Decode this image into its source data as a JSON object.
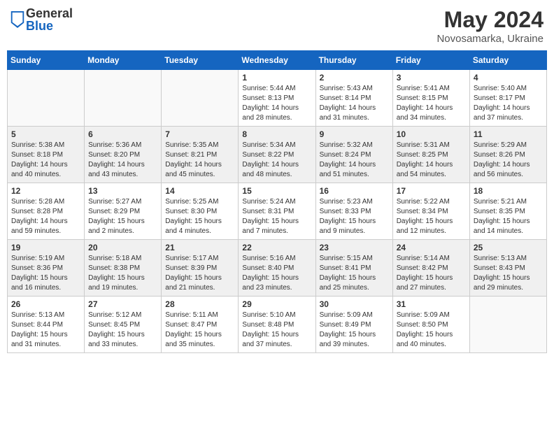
{
  "header": {
    "logo_general": "General",
    "logo_blue": "Blue",
    "month_year": "May 2024",
    "location": "Novosamarka, Ukraine"
  },
  "days_of_week": [
    "Sunday",
    "Monday",
    "Tuesday",
    "Wednesday",
    "Thursday",
    "Friday",
    "Saturday"
  ],
  "weeks": [
    {
      "shaded": false,
      "days": [
        {
          "number": "",
          "sunrise": "",
          "sunset": "",
          "daylight": "",
          "empty": true
        },
        {
          "number": "",
          "sunrise": "",
          "sunset": "",
          "daylight": "",
          "empty": true
        },
        {
          "number": "",
          "sunrise": "",
          "sunset": "",
          "daylight": "",
          "empty": true
        },
        {
          "number": "1",
          "sunrise": "Sunrise: 5:44 AM",
          "sunset": "Sunset: 8:13 PM",
          "daylight": "Daylight: 14 hours and 28 minutes.",
          "empty": false
        },
        {
          "number": "2",
          "sunrise": "Sunrise: 5:43 AM",
          "sunset": "Sunset: 8:14 PM",
          "daylight": "Daylight: 14 hours and 31 minutes.",
          "empty": false
        },
        {
          "number": "3",
          "sunrise": "Sunrise: 5:41 AM",
          "sunset": "Sunset: 8:15 PM",
          "daylight": "Daylight: 14 hours and 34 minutes.",
          "empty": false
        },
        {
          "number": "4",
          "sunrise": "Sunrise: 5:40 AM",
          "sunset": "Sunset: 8:17 PM",
          "daylight": "Daylight: 14 hours and 37 minutes.",
          "empty": false
        }
      ]
    },
    {
      "shaded": true,
      "days": [
        {
          "number": "5",
          "sunrise": "Sunrise: 5:38 AM",
          "sunset": "Sunset: 8:18 PM",
          "daylight": "Daylight: 14 hours and 40 minutes.",
          "empty": false
        },
        {
          "number": "6",
          "sunrise": "Sunrise: 5:36 AM",
          "sunset": "Sunset: 8:20 PM",
          "daylight": "Daylight: 14 hours and 43 minutes.",
          "empty": false
        },
        {
          "number": "7",
          "sunrise": "Sunrise: 5:35 AM",
          "sunset": "Sunset: 8:21 PM",
          "daylight": "Daylight: 14 hours and 45 minutes.",
          "empty": false
        },
        {
          "number": "8",
          "sunrise": "Sunrise: 5:34 AM",
          "sunset": "Sunset: 8:22 PM",
          "daylight": "Daylight: 14 hours and 48 minutes.",
          "empty": false
        },
        {
          "number": "9",
          "sunrise": "Sunrise: 5:32 AM",
          "sunset": "Sunset: 8:24 PM",
          "daylight": "Daylight: 14 hours and 51 minutes.",
          "empty": false
        },
        {
          "number": "10",
          "sunrise": "Sunrise: 5:31 AM",
          "sunset": "Sunset: 8:25 PM",
          "daylight": "Daylight: 14 hours and 54 minutes.",
          "empty": false
        },
        {
          "number": "11",
          "sunrise": "Sunrise: 5:29 AM",
          "sunset": "Sunset: 8:26 PM",
          "daylight": "Daylight: 14 hours and 56 minutes.",
          "empty": false
        }
      ]
    },
    {
      "shaded": false,
      "days": [
        {
          "number": "12",
          "sunrise": "Sunrise: 5:28 AM",
          "sunset": "Sunset: 8:28 PM",
          "daylight": "Daylight: 14 hours and 59 minutes.",
          "empty": false
        },
        {
          "number": "13",
          "sunrise": "Sunrise: 5:27 AM",
          "sunset": "Sunset: 8:29 PM",
          "daylight": "Daylight: 15 hours and 2 minutes.",
          "empty": false
        },
        {
          "number": "14",
          "sunrise": "Sunrise: 5:25 AM",
          "sunset": "Sunset: 8:30 PM",
          "daylight": "Daylight: 15 hours and 4 minutes.",
          "empty": false
        },
        {
          "number": "15",
          "sunrise": "Sunrise: 5:24 AM",
          "sunset": "Sunset: 8:31 PM",
          "daylight": "Daylight: 15 hours and 7 minutes.",
          "empty": false
        },
        {
          "number": "16",
          "sunrise": "Sunrise: 5:23 AM",
          "sunset": "Sunset: 8:33 PM",
          "daylight": "Daylight: 15 hours and 9 minutes.",
          "empty": false
        },
        {
          "number": "17",
          "sunrise": "Sunrise: 5:22 AM",
          "sunset": "Sunset: 8:34 PM",
          "daylight": "Daylight: 15 hours and 12 minutes.",
          "empty": false
        },
        {
          "number": "18",
          "sunrise": "Sunrise: 5:21 AM",
          "sunset": "Sunset: 8:35 PM",
          "daylight": "Daylight: 15 hours and 14 minutes.",
          "empty": false
        }
      ]
    },
    {
      "shaded": true,
      "days": [
        {
          "number": "19",
          "sunrise": "Sunrise: 5:19 AM",
          "sunset": "Sunset: 8:36 PM",
          "daylight": "Daylight: 15 hours and 16 minutes.",
          "empty": false
        },
        {
          "number": "20",
          "sunrise": "Sunrise: 5:18 AM",
          "sunset": "Sunset: 8:38 PM",
          "daylight": "Daylight: 15 hours and 19 minutes.",
          "empty": false
        },
        {
          "number": "21",
          "sunrise": "Sunrise: 5:17 AM",
          "sunset": "Sunset: 8:39 PM",
          "daylight": "Daylight: 15 hours and 21 minutes.",
          "empty": false
        },
        {
          "number": "22",
          "sunrise": "Sunrise: 5:16 AM",
          "sunset": "Sunset: 8:40 PM",
          "daylight": "Daylight: 15 hours and 23 minutes.",
          "empty": false
        },
        {
          "number": "23",
          "sunrise": "Sunrise: 5:15 AM",
          "sunset": "Sunset: 8:41 PM",
          "daylight": "Daylight: 15 hours and 25 minutes.",
          "empty": false
        },
        {
          "number": "24",
          "sunrise": "Sunrise: 5:14 AM",
          "sunset": "Sunset: 8:42 PM",
          "daylight": "Daylight: 15 hours and 27 minutes.",
          "empty": false
        },
        {
          "number": "25",
          "sunrise": "Sunrise: 5:13 AM",
          "sunset": "Sunset: 8:43 PM",
          "daylight": "Daylight: 15 hours and 29 minutes.",
          "empty": false
        }
      ]
    },
    {
      "shaded": false,
      "days": [
        {
          "number": "26",
          "sunrise": "Sunrise: 5:13 AM",
          "sunset": "Sunset: 8:44 PM",
          "daylight": "Daylight: 15 hours and 31 minutes.",
          "empty": false
        },
        {
          "number": "27",
          "sunrise": "Sunrise: 5:12 AM",
          "sunset": "Sunset: 8:45 PM",
          "daylight": "Daylight: 15 hours and 33 minutes.",
          "empty": false
        },
        {
          "number": "28",
          "sunrise": "Sunrise: 5:11 AM",
          "sunset": "Sunset: 8:47 PM",
          "daylight": "Daylight: 15 hours and 35 minutes.",
          "empty": false
        },
        {
          "number": "29",
          "sunrise": "Sunrise: 5:10 AM",
          "sunset": "Sunset: 8:48 PM",
          "daylight": "Daylight: 15 hours and 37 minutes.",
          "empty": false
        },
        {
          "number": "30",
          "sunrise": "Sunrise: 5:09 AM",
          "sunset": "Sunset: 8:49 PM",
          "daylight": "Daylight: 15 hours and 39 minutes.",
          "empty": false
        },
        {
          "number": "31",
          "sunrise": "Sunrise: 5:09 AM",
          "sunset": "Sunset: 8:50 PM",
          "daylight": "Daylight: 15 hours and 40 minutes.",
          "empty": false
        },
        {
          "number": "",
          "sunrise": "",
          "sunset": "",
          "daylight": "",
          "empty": true
        }
      ]
    }
  ]
}
